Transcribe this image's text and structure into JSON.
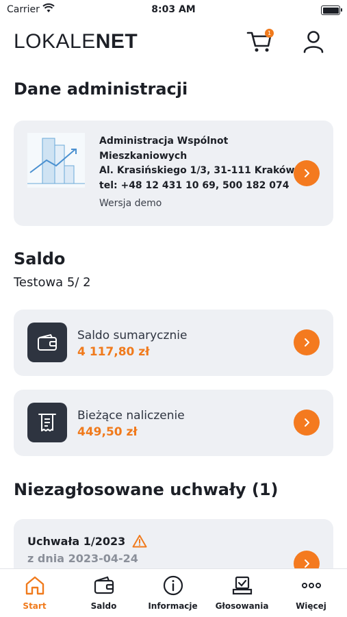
{
  "status": {
    "carrier": "Carrier",
    "time": "8:03 AM"
  },
  "header": {
    "logo_thin": "LOKALE",
    "logo_bold": "NET",
    "cart_count": "1"
  },
  "admin_section": {
    "title": "Dane administracji",
    "line1": "Administracja Wspólnot",
    "line2": "Mieszkaniowych",
    "line3": "Al. Krasińskiego 1/3, 31-111 Kraków",
    "line4": "tel: +48 12 431 10 69, 500 182 074",
    "demo": "Wersja demo"
  },
  "saldo_section": {
    "title": "Saldo",
    "subtitle": "Testowa 5/ 2",
    "cards": [
      {
        "label": "Saldo sumarycznie",
        "value": "4 117,80 zł",
        "icon": "wallet-icon"
      },
      {
        "label": "Bieżące naliczenie",
        "value": "449,50 zł",
        "icon": "receipt-icon"
      }
    ]
  },
  "uchwaly_section": {
    "title": "Niezagłosowane uchwały (1)",
    "item_title": "Uchwała 1/2023",
    "item_date": "z dnia 2023-04-24"
  },
  "tabbar": [
    {
      "label": "Start",
      "icon": "home-icon",
      "active": true
    },
    {
      "label": "Saldo",
      "icon": "wallet-icon",
      "active": false
    },
    {
      "label": "Informacje",
      "icon": "info-icon",
      "active": false
    },
    {
      "label": "Głosowania",
      "icon": "vote-icon",
      "active": false
    },
    {
      "label": "Więcej",
      "icon": "more-icon",
      "active": false
    }
  ],
  "colors": {
    "accent": "#f07a1c",
    "card_bg": "#eef0f4",
    "icon_box": "#2e3440",
    "text": "#1c1f26"
  }
}
